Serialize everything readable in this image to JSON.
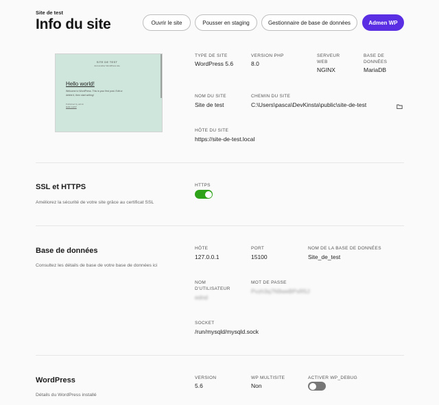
{
  "header": {
    "site_name": "Site de test",
    "title": "Info du site",
    "buttons": {
      "open_site": "Ouvrir le site",
      "push_staging": "Pousser en staging",
      "db_manager": "Gestionnaire de base de données",
      "admin_wp": "Admen WP"
    },
    "accent_color": "#5a2fe3"
  },
  "preview": {
    "site_title": "SITE DE TEST",
    "tagline": "Just another WordPress site",
    "post_title": "Hello world!",
    "post_body": "Welcome to WordPress. This is your first post. Edit or delete it, then start writing!",
    "meta": "Published by admin",
    "link": "Hello world!"
  },
  "info": {
    "site_type_label": "TYPE DE SITE",
    "site_type": "WordPress 5.6",
    "php_label": "VERSION PHP",
    "php": "8.0",
    "server_label_1": "SERVEUR",
    "server_label_2": "WEB",
    "server": "NGINX",
    "db_label_1": "BASE DE",
    "db_label_2": "DONNÉES",
    "db": "MariaDB",
    "name_label": "NOM DU SITE",
    "name": "Site de test",
    "path_label": "CHEMIN DU SITE",
    "path": "C:\\Users\\pasca\\DevKinsta\\public\\site-de-test",
    "host_label": "HÔTE DU SITE",
    "host": "https://site-de-test.local",
    "folder_icon": "folder-icon"
  },
  "ssl": {
    "title": "SSL et HTTPS",
    "desc": "Améliorez la sécurité de votre site grâce au certificat SSL",
    "https_label": "HTTPS",
    "https_on": true,
    "on_color": "#2ea31a"
  },
  "database": {
    "title": "Base de données",
    "desc": "Consultez les détails de base de votre base de données ici",
    "host_label": "HÔTE",
    "host": "127.0.0.1",
    "port_label": "PORT",
    "port": "15100",
    "dbname_label": "NOM DE LA BASE DE DONNÉES",
    "dbname": "Site_de_test",
    "user_label_1": "NOM",
    "user_label_2": "D'UTILISATEUR",
    "user": "ednd",
    "password_label": "MOT DE PASSE",
    "password": "Pvzh3q7N9weBPxR5J",
    "socket_label": "SOCKET",
    "socket": "/run/mysqld/mysqld.sock"
  },
  "wordpress": {
    "title": "WordPress",
    "desc": "Détails du WordPress installé",
    "version_label": "VERSION",
    "version": "5.6",
    "multisite_label": "WP MULTISITE",
    "multisite": "Non",
    "debug_label": "ACTIVER WP_DEBUG",
    "debug_on": false,
    "off_color": "#777777"
  }
}
